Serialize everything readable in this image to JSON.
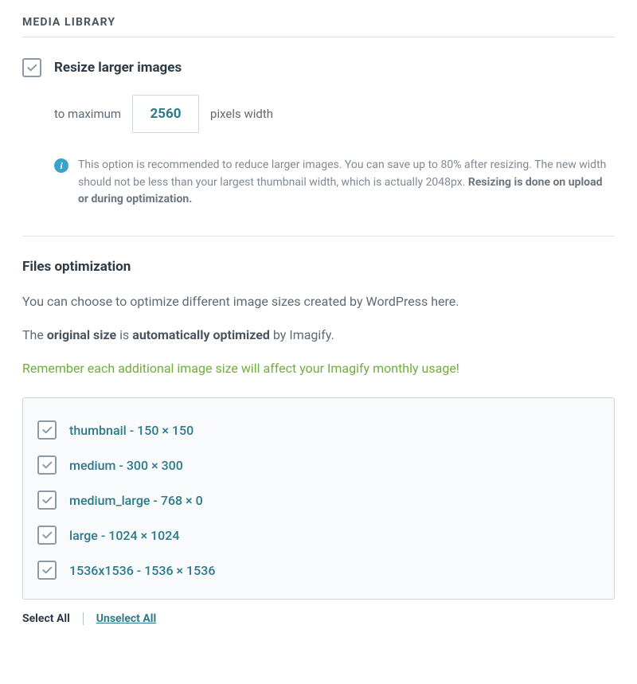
{
  "header": {
    "title": "MEDIA LIBRARY"
  },
  "resize": {
    "label": "Resize larger images",
    "prefix": "to maximum",
    "value": "2560",
    "suffix": "pixels width",
    "info_part1": "This option is recommended to reduce larger images. You can save up to 80% after resizing. The new width should not be less than your largest thumbnail width, which is actually 2048px. ",
    "info_bold": "Resizing is done on upload or during optimization."
  },
  "files_opt": {
    "title": "Files optimization",
    "desc1": "You can choose to optimize different image sizes created by WordPress here.",
    "desc2_a": "The ",
    "desc2_b": "original size",
    "desc2_c": " is ",
    "desc2_d": "automatically optimized",
    "desc2_e": " by Imagify.",
    "green": "Remember each additional image size will affect your Imagify monthly usage!",
    "sizes": [
      {
        "label": "thumbnail - 150 × 150"
      },
      {
        "label": "medium - 300 × 300"
      },
      {
        "label": "medium_large - 768 × 0"
      },
      {
        "label": "large - 1024 × 1024"
      },
      {
        "label": "1536x1536 - 1536 × 1536"
      }
    ],
    "select_all": "Select All",
    "unselect_all": "Unselect All"
  }
}
